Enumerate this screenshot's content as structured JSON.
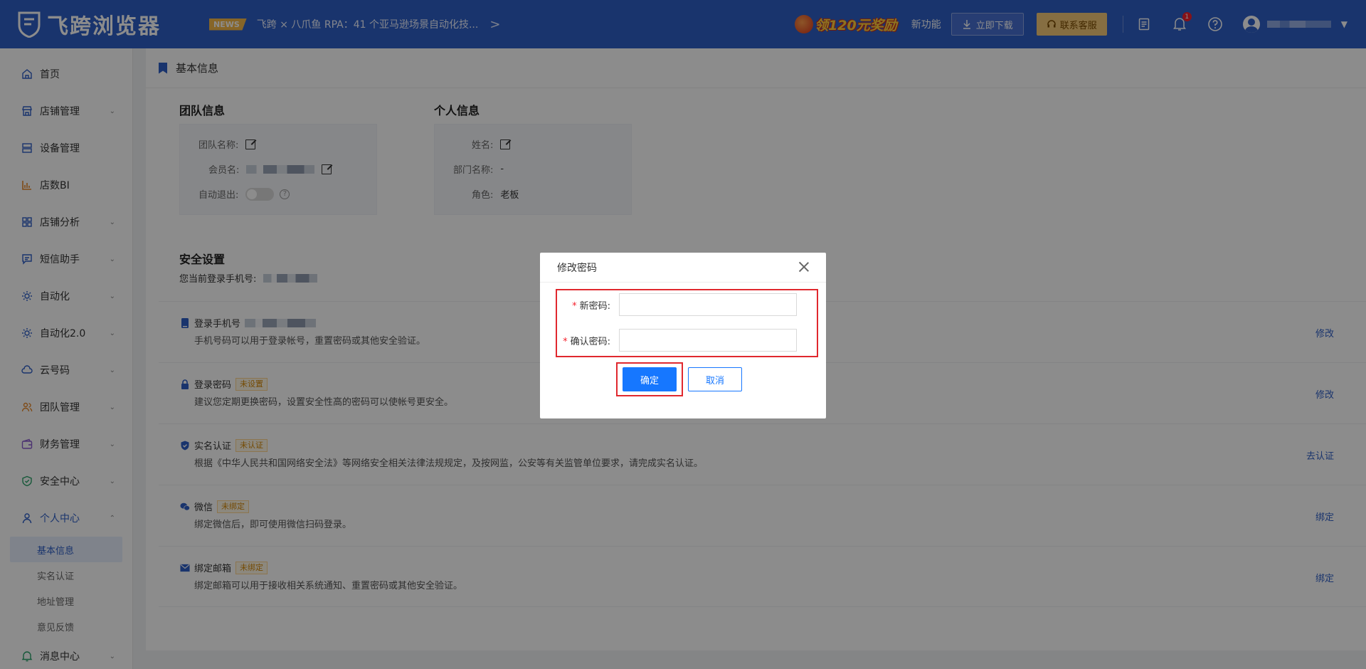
{
  "header": {
    "app_name": "飞跨浏览器",
    "news_badge": "NEWS",
    "news_text": "飞跨 × 八爪鱼 RPA：41 个亚马逊场景自动化技...",
    "news_arrow": ">",
    "reward_text": "领120元奖励",
    "new_feature": "新功能",
    "download": "立即下载",
    "contact": "联系客服",
    "notification_count": "1"
  },
  "sidebar": {
    "items": [
      {
        "label": "首页",
        "icon": "home-icon"
      },
      {
        "label": "店铺管理",
        "icon": "store-icon"
      },
      {
        "label": "设备管理",
        "icon": "server-icon"
      },
      {
        "label": "店数BI",
        "icon": "bar-chart-icon"
      },
      {
        "label": "店铺分析",
        "icon": "grid-icon"
      },
      {
        "label": "短信助手",
        "icon": "message-icon"
      },
      {
        "label": "自动化",
        "icon": "gear-icon"
      },
      {
        "label": "自动化2.0",
        "icon": "gear-icon"
      },
      {
        "label": "云号码",
        "icon": "cloud-icon"
      },
      {
        "label": "团队管理",
        "icon": "team-icon"
      },
      {
        "label": "财务管理",
        "icon": "wallet-icon"
      },
      {
        "label": "安全中心",
        "icon": "shield-icon"
      },
      {
        "label": "个人中心",
        "icon": "user-icon"
      }
    ],
    "sub_items": [
      "基本信息",
      "实名认证",
      "地址管理",
      "意见反馈"
    ],
    "last_item": {
      "label": "消息中心",
      "icon": "bell-icon"
    }
  },
  "main": {
    "breadcrumb": "基本信息",
    "team_info": {
      "title": "团队信息",
      "team_name_label": "团队名称:",
      "member_label": "会员名:",
      "auto_logout_label": "自动退出:"
    },
    "personal_info": {
      "title": "个人信息",
      "name_label": "姓名:",
      "dept_label": "部门名称:",
      "dept_value": "-",
      "role_label": "角色:",
      "role_value": "老板"
    },
    "security": {
      "title": "安全设置",
      "phone_label": "您当前登录手机号:",
      "rows": [
        {
          "icon": "phone-icon",
          "title": "登录手机号",
          "tag": "",
          "desc": "手机号码可以用于登录帐号，重置密码或其他安全验证。",
          "action": "修改"
        },
        {
          "icon": "lock-icon",
          "title": "登录密码",
          "tag": "未设置",
          "desc": "建议您定期更换密码，设置安全性高的密码可以使帐号更安全。",
          "action": "修改"
        },
        {
          "icon": "shield-check-icon",
          "title": "实名认证",
          "tag": "未认证",
          "desc": "根据《中华人民共和国网络安全法》等网络安全相关法律法规规定，及按网监，公安等有关监管单位要求，请完成实名认证。",
          "action": "去认证"
        },
        {
          "icon": "wechat-icon",
          "title": "微信",
          "tag": "未绑定",
          "desc": "绑定微信后，即可使用微信扫码登录。",
          "action": "绑定"
        },
        {
          "icon": "mail-icon",
          "title": "绑定邮箱",
          "tag": "未绑定",
          "desc": "绑定邮箱可以用于接收相关系统通知、重置密码或其他安全验证。",
          "action": "绑定"
        }
      ]
    }
  },
  "modal": {
    "title": "修改密码",
    "new_password_label": "新密码:",
    "confirm_password_label": "确认密码:",
    "required_mark": "*",
    "ok": "确定",
    "cancel": "取消"
  },
  "colors": {
    "brand": "#2f5fc7",
    "primary_button": "#1677ff",
    "highlight": "#e0282e",
    "warning_tag": "#d48806"
  }
}
